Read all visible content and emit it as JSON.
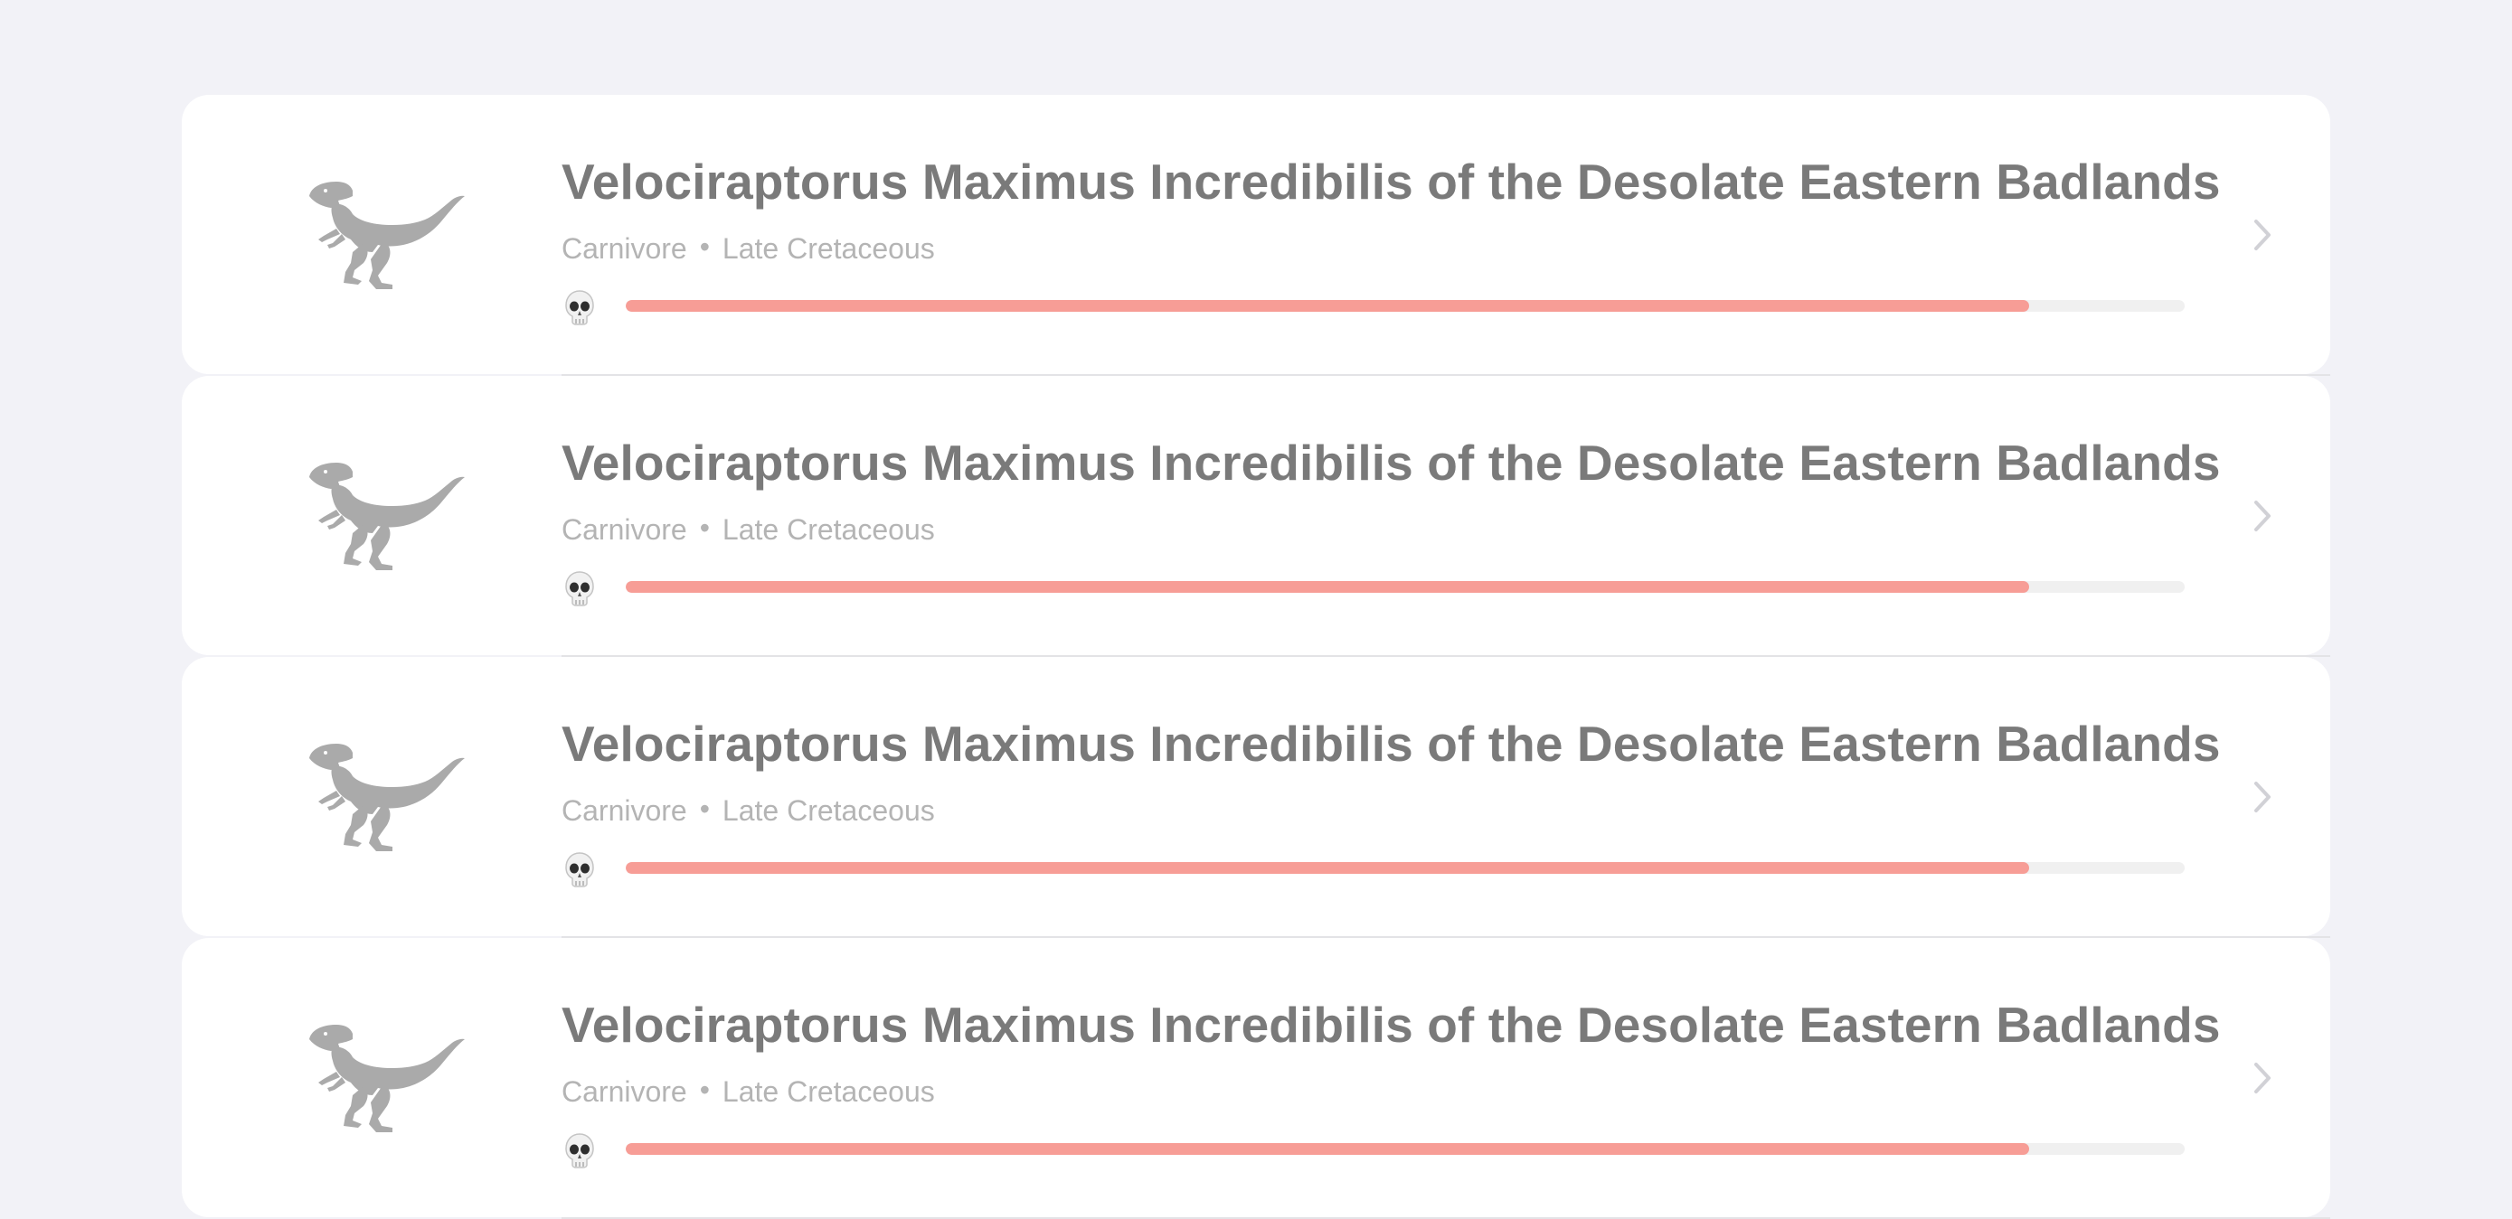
{
  "items": [
    {
      "title": "Velociraptorus Maximus Incredibilis of the Desolate Eastern Badlands",
      "diet": "Carnivore",
      "separator": "•",
      "period": "Late Cretaceous",
      "danger_level": 0.9,
      "thumbnail_icon": "velociraptor-silhouette-icon",
      "danger_icon": "skull-icon",
      "disclosure_icon": "chevron-right-icon"
    },
    {
      "title": "Velociraptorus Maximus Incredibilis of the Desolate Eastern Badlands",
      "diet": "Carnivore",
      "separator": "•",
      "period": "Late Cretaceous",
      "danger_level": 0.9,
      "thumbnail_icon": "velociraptor-silhouette-icon",
      "danger_icon": "skull-icon",
      "disclosure_icon": "chevron-right-icon"
    },
    {
      "title": "Velociraptorus Maximus Incredibilis of the Desolate Eastern Badlands",
      "diet": "Carnivore",
      "separator": "•",
      "period": "Late Cretaceous",
      "danger_level": 0.9,
      "thumbnail_icon": "velociraptor-silhouette-icon",
      "danger_icon": "skull-icon",
      "disclosure_icon": "chevron-right-icon"
    },
    {
      "title": "Velociraptorus Maximus Incredibilis of the Desolate Eastern Badlands",
      "diet": "Carnivore",
      "separator": "•",
      "period": "Late Cretaceous",
      "danger_level": 0.9,
      "thumbnail_icon": "velociraptor-silhouette-icon",
      "danger_icon": "skull-icon",
      "disclosure_icon": "chevron-right-icon"
    }
  ],
  "colors": {
    "background": "#f2f2f7",
    "card": "#ffffff",
    "title": "#7a7a7a",
    "meta": "#b4b4b4",
    "progress_fill": "#f79d96",
    "progress_track": "#f0f0f0",
    "icon": "#aaaaaa",
    "chevron": "#d1d1d6"
  }
}
